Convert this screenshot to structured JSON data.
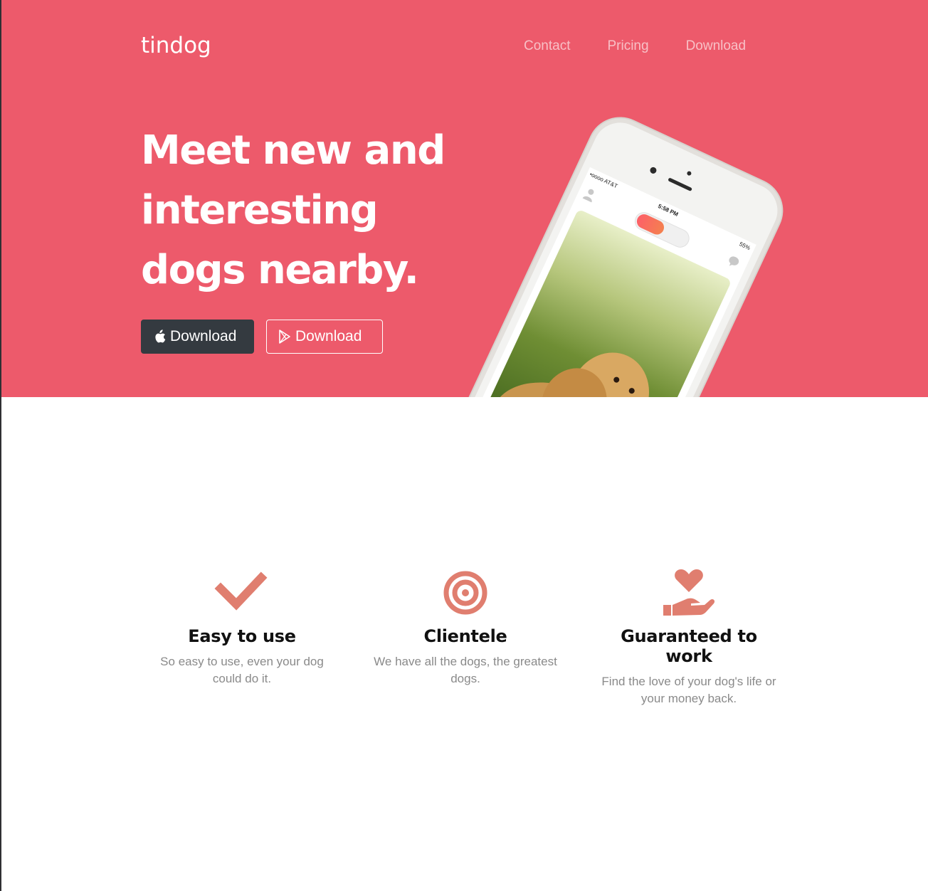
{
  "brand": "tindog",
  "nav": [
    "Contact",
    "Pricing",
    "Download"
  ],
  "hero": {
    "headline": [
      "Meet new and",
      "interesting",
      "dogs nearby."
    ],
    "apple_button": "Download",
    "play_button": "Download"
  },
  "phone": {
    "carrier": "•oooo AT&T",
    "time": "5:58 PM",
    "battery": "55%"
  },
  "features": [
    {
      "icon": "checkmark-icon",
      "title": "Easy to use",
      "text": "So easy to use, even your dog could do it."
    },
    {
      "icon": "target-icon",
      "title": "Clientele",
      "text": "We have all the dogs, the greatest dogs."
    },
    {
      "icon": "heart-hand-icon",
      "title": "Guaranteed to work",
      "text": "Find the love of your dog's life or your money back."
    }
  ],
  "colors": {
    "hero_bg": "#ed5a6b",
    "feature_icon": "#e07e6f",
    "apple_button_bg": "#343a40"
  }
}
